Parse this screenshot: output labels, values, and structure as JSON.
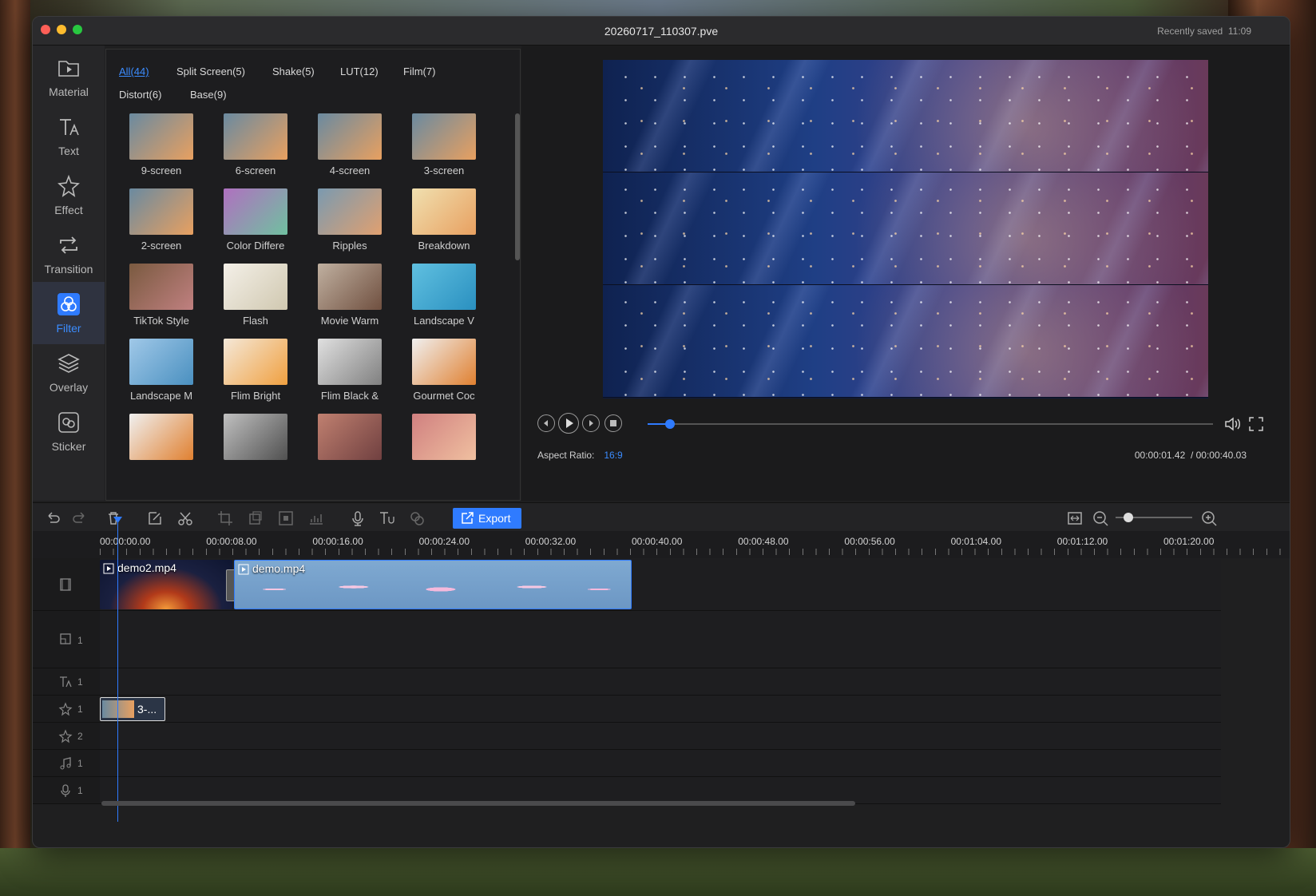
{
  "window": {
    "title": "20260717_110307.pve",
    "saved_label": "Recently saved",
    "saved_time": "11:09"
  },
  "sidebar": [
    {
      "name": "material",
      "label": "Material",
      "icon": "folder-play-icon"
    },
    {
      "name": "text",
      "label": "Text",
      "icon": "text-icon"
    },
    {
      "name": "effect",
      "label": "Effect",
      "icon": "sparkle-star-icon"
    },
    {
      "name": "transition",
      "label": "Transition",
      "icon": "transition-arrows-icon"
    },
    {
      "name": "filter",
      "label": "Filter",
      "icon": "filter-circles-icon",
      "active": true
    },
    {
      "name": "overlay",
      "label": "Overlay",
      "icon": "layers-icon"
    },
    {
      "name": "sticker",
      "label": "Sticker",
      "icon": "sticker-icon"
    }
  ],
  "tabs": [
    "All(44)",
    "Split Screen(5)",
    "Shake(5)",
    "LUT(12)",
    "Film(7)",
    "Distort(6)",
    "Base(9)"
  ],
  "filters": [
    {
      "label": "9-screen",
      "colors": [
        "#6a8aa0",
        "#e8a060"
      ]
    },
    {
      "label": "6-screen",
      "colors": [
        "#6a8aa0",
        "#e8a060"
      ]
    },
    {
      "label": "4-screen",
      "colors": [
        "#6a8aa0",
        "#e8a060"
      ]
    },
    {
      "label": "3-screen",
      "colors": [
        "#6a8aa0",
        "#e8a060"
      ]
    },
    {
      "label": "2-screen",
      "colors": [
        "#6a8aa0",
        "#e8a060"
      ]
    },
    {
      "label": "Color Differe",
      "colors": [
        "#b070c0",
        "#70c0a0"
      ]
    },
    {
      "label": "Ripples",
      "colors": [
        "#7a9ab0",
        "#e0a070"
      ]
    },
    {
      "label": "Breakdown",
      "colors": [
        "#f0e0b0",
        "#e8a060"
      ]
    },
    {
      "label": "TikTok Style",
      "colors": [
        "#7a5a40",
        "#c08080"
      ]
    },
    {
      "label": "Flash",
      "colors": [
        "#f4f0e8",
        "#d0c8b0"
      ]
    },
    {
      "label": "Movie Warm",
      "colors": [
        "#c0b0a0",
        "#705040"
      ]
    },
    {
      "label": "Landscape V",
      "colors": [
        "#60c0e0",
        "#2a90c0"
      ]
    },
    {
      "label": "Landscape M",
      "colors": [
        "#a0c8e8",
        "#4a90c0"
      ]
    },
    {
      "label": "Flim Bright",
      "colors": [
        "#f4e8d8",
        "#f0a040"
      ]
    },
    {
      "label": "Flim Black &",
      "colors": [
        "#e0e0e0",
        "#808080"
      ]
    },
    {
      "label": "Gourmet Coc",
      "colors": [
        "#f0f0f0",
        "#e08030"
      ]
    },
    {
      "label": "",
      "colors": [
        "#f0f0f0",
        "#e08030"
      ]
    },
    {
      "label": "",
      "colors": [
        "#c0c0c0",
        "#505050"
      ]
    },
    {
      "label": "",
      "colors": [
        "#c08070",
        "#704040"
      ]
    },
    {
      "label": "",
      "colors": [
        "#d08080",
        "#f0c0a0"
      ]
    }
  ],
  "preview": {
    "aspect_label": "Aspect Ratio:",
    "aspect_value": "16:9",
    "current_time": "00:00:01.42",
    "total_time": "/ 00:00:40.03",
    "progress": 0.04
  },
  "toolbar": {
    "export_label": "Export"
  },
  "ruler": [
    "00:00:00.00",
    "00:00:08.00",
    "00:00:16.00",
    "00:00:24.00",
    "00:00:32.00",
    "00:00:40.00",
    "00:00:48.00",
    "00:00:56.00",
    "00:01:04.00",
    "00:01:12.00",
    "00:01:20.00"
  ],
  "tracks": [
    {
      "icon": "film-strip-icon",
      "num": ""
    },
    {
      "icon": "overlay-track-icon",
      "num": "1"
    },
    {
      "icon": "text-track-icon",
      "num": "1"
    },
    {
      "icon": "effect-track-icon",
      "num": "1"
    },
    {
      "icon": "effect-track-icon",
      "num": "2"
    },
    {
      "icon": "music-note-icon",
      "num": "1"
    },
    {
      "icon": "microphone-icon",
      "num": "1"
    }
  ],
  "clips": {
    "video1": "demo2.mp4",
    "video2": "demo.mp4",
    "effect1": "3-..."
  },
  "colors": {
    "accent": "#2f7bff"
  }
}
